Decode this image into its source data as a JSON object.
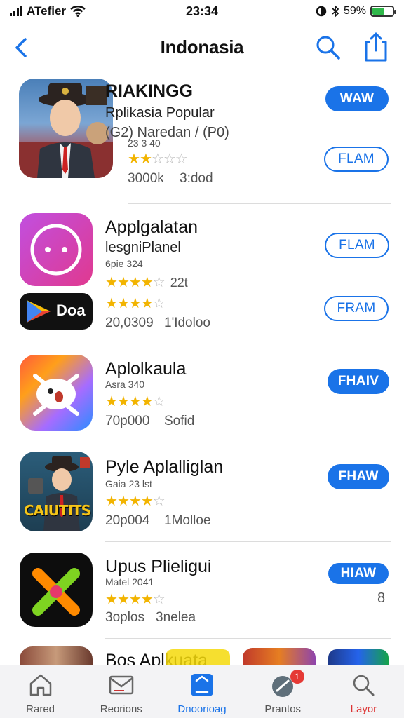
{
  "status_bar": {
    "carrier": "ATefier",
    "time": "23:34",
    "battery_pct": "59%",
    "battery_level": 0.59
  },
  "nav": {
    "title": "Indonasia"
  },
  "apps": [
    {
      "name": "RIAKINGG",
      "subtitle": "Rplikasia Popular",
      "detail": "(G2) Naredan / (P0)",
      "small": "23 3 40",
      "stars": 2,
      "meta_a": "3000k",
      "meta_b": "3:dod",
      "primary_button": "WAW",
      "secondary_button": "FLAM"
    },
    {
      "name": "Applgalatan",
      "subtitle": "lesgniPlanel",
      "small": "6pie 324",
      "stars": 4,
      "stars_extra": "22t",
      "secondary_logo_text": "Doa",
      "stars2": 4,
      "meta_a": "20,0309",
      "meta_b": "1'Idoloo",
      "primary_button": "FLAM",
      "secondary_button": "FRAM"
    },
    {
      "name": "Aplolkaula",
      "small": "Asra 340",
      "stars": 4,
      "meta_a": "70p000",
      "meta_b": "Sofid",
      "primary_button": "FHAIV"
    },
    {
      "name": "Pyle Aplalliglan",
      "small": "Gaia 23 lst",
      "stars": 4,
      "meta_a": "20p004",
      "meta_b": "1Molloe",
      "primary_button": "FHAW",
      "icon_banner_text": "CAIUTITS"
    },
    {
      "name": "Upus Plieligui",
      "small": "Matel 2041",
      "stars": 4,
      "meta_a": "3oplos",
      "meta_b": "3nelea",
      "primary_button": "HIAW",
      "side_number": "8"
    },
    {
      "name": "Bos Aplkuata"
    }
  ],
  "tab_bar": {
    "tabs": [
      {
        "label": "Rared",
        "icon": "home-icon"
      },
      {
        "label": "Reorions",
        "icon": "mail-icon"
      },
      {
        "label": "Dnoorioag",
        "icon": "apps-icon"
      },
      {
        "label": "Prantos",
        "icon": "badge-icon",
        "badge": "1"
      },
      {
        "label": "Layor",
        "icon": "search-icon"
      }
    ]
  },
  "colors": {
    "accent": "#1a73e8",
    "star": "#f2b400",
    "battery": "#2fb84a",
    "badge": "#e53935"
  }
}
